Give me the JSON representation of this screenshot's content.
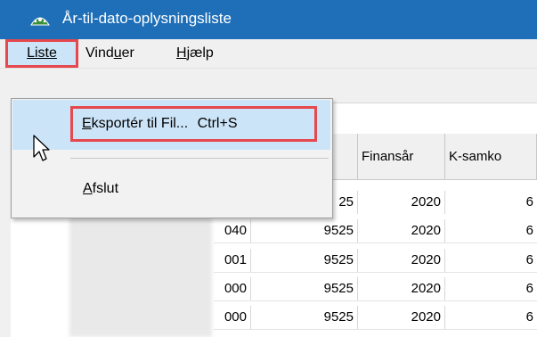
{
  "window": {
    "title": "År-til-dato-oplysningsliste"
  },
  "menubar": {
    "items": [
      {
        "label": "Liste"
      },
      {
        "label_prefix": "Vind",
        "label_underlined": "u",
        "label_suffix": "er"
      },
      {
        "label_prefix": "",
        "label_underlined": "H",
        "label_suffix": "jælp"
      }
    ]
  },
  "dropdown": {
    "export_label_prefix": "",
    "export_label_underlined": "E",
    "export_label_suffix": "ksportér til Fil...",
    "export_shortcut": "Ctrl+S",
    "exit_label_underlined": "A",
    "exit_label_suffix": "fslut"
  },
  "table": {
    "headers": [
      "",
      "Finansår",
      "K-samko"
    ],
    "rows": [
      {
        "c1": "",
        "c2": "25",
        "c3": "2020",
        "c4": "6"
      },
      {
        "c1": "040",
        "c2": "9525",
        "c3": "2020",
        "c4": "6"
      },
      {
        "c1": "001",
        "c2": "9525",
        "c3": "2020",
        "c4": "6"
      },
      {
        "c1": "000",
        "c2": "9525",
        "c3": "2020",
        "c4": "6"
      },
      {
        "c1": "000",
        "c2": "9525",
        "c3": "2020",
        "c4": "6"
      }
    ]
  },
  "colors": {
    "titlebar": "#1f6fb8",
    "highlight": "#cce4f7",
    "annotation": "#e5484d"
  }
}
